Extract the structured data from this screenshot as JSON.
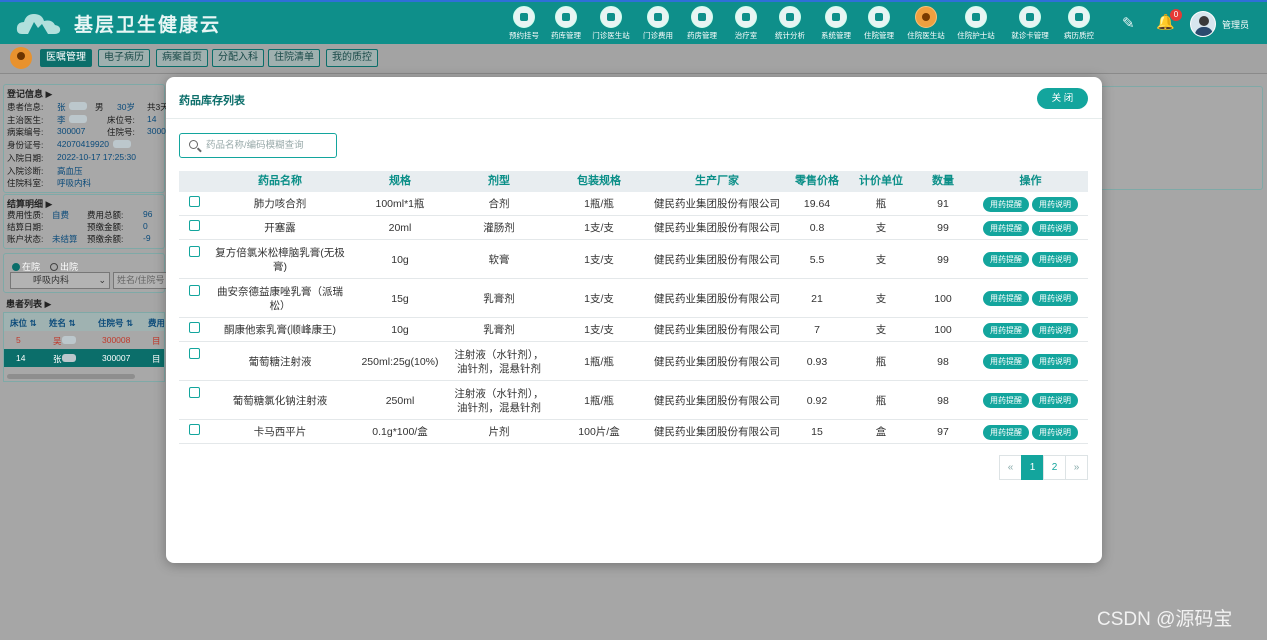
{
  "app": {
    "title": "基层卫生健康云"
  },
  "nav": {
    "items": [
      {
        "label": "预约挂号"
      },
      {
        "label": "药库管理"
      },
      {
        "label": "门诊医生站"
      },
      {
        "label": "门诊费用"
      },
      {
        "label": "药房管理"
      },
      {
        "label": "治疗室"
      },
      {
        "label": "统计分析"
      },
      {
        "label": "系统管理"
      },
      {
        "label": "住院管理"
      },
      {
        "label": "住院医生站",
        "active": true
      },
      {
        "label": "住院护士站"
      },
      {
        "label": "就诊卡管理"
      },
      {
        "label": "病历质控"
      }
    ],
    "notification_count": "0",
    "user_name": "管理员"
  },
  "subtabs": [
    {
      "label": "医嘱管理",
      "active": true
    },
    {
      "label": "电子病历"
    },
    {
      "label": "病案首页"
    },
    {
      "label": "分配入科"
    },
    {
      "label": "住院清单"
    },
    {
      "label": "我的质控"
    }
  ],
  "left": {
    "reg_title": "登记信息",
    "reg_rows": [
      [
        "患者信息:",
        "张",
        "男",
        "30岁",
        "共3天"
      ],
      [
        "主治医生:",
        "李",
        "床位号:",
        "14"
      ],
      [
        "病案编号:",
        "300007",
        "住院号:",
        "3000"
      ],
      [
        "身份证号:",
        "42070419920"
      ],
      [
        "入院日期:",
        "2022-10-17 17:25:30"
      ],
      [
        "入院诊断:",
        "高血压"
      ],
      [
        "住院科室:",
        "呼吸内科"
      ]
    ],
    "settle_title": "结算明细",
    "settle_rows": [
      [
        "费用性质:",
        "自费",
        "费用总额:",
        "96"
      ],
      [
        "结算日期:",
        "",
        "预缴金额:",
        "0"
      ],
      [
        "账户状态:",
        "未结算",
        "预缴余额:",
        "-9"
      ]
    ],
    "status_options": [
      "在院",
      "出院"
    ],
    "dept_select": "呼吸内科",
    "name_search_placeholder": "姓名/住院号",
    "patient_list_title": "患者列表",
    "patient_columns": [
      "床位",
      "姓名",
      "住院号",
      "费用"
    ],
    "patients": [
      {
        "bed": "5",
        "name": "吴",
        "no": "300008",
        "fee": "目"
      },
      {
        "bed": "14",
        "name": "张",
        "no": "300007",
        "fee": "目"
      }
    ]
  },
  "modal": {
    "title": "药品库存列表",
    "close_label": "关 闭",
    "search_placeholder": "药品名称/编码模糊查询",
    "columns": [
      "药品名称",
      "规格",
      "剂型",
      "包装规格",
      "生产厂家",
      "零售价格",
      "计价单位",
      "数量",
      "操作"
    ],
    "op_labels": [
      "用药提醒",
      "用药说明"
    ],
    "rows": [
      {
        "name": "肺力咳合剂",
        "spec": "100ml*1瓶",
        "form": "合剂",
        "pack": "1瓶/瓶",
        "maker": "健民药业集团股份有限公司",
        "price": "19.64",
        "unit": "瓶",
        "qty": "91"
      },
      {
        "name": "开塞露",
        "spec": "20ml",
        "form": "灌肠剂",
        "pack": "1支/支",
        "maker": "健民药业集团股份有限公司",
        "price": "0.8",
        "unit": "支",
        "qty": "99"
      },
      {
        "name": "复方倍氯米松樟脑乳膏(无极膏)",
        "spec": "10g",
        "form": "软膏",
        "pack": "1支/支",
        "maker": "健民药业集团股份有限公司",
        "price": "5.5",
        "unit": "支",
        "qty": "99"
      },
      {
        "name": "曲安奈德益康唑乳膏（派瑞松）",
        "spec": "15g",
        "form": "乳膏剂",
        "pack": "1支/支",
        "maker": "健民药业集团股份有限公司",
        "price": "21",
        "unit": "支",
        "qty": "100"
      },
      {
        "name": "酮康他索乳膏(顺峰康王)",
        "spec": "10g",
        "form": "乳膏剂",
        "pack": "1支/支",
        "maker": "健民药业集团股份有限公司",
        "price": "7",
        "unit": "支",
        "qty": "100"
      },
      {
        "name": "葡萄糖注射液",
        "spec": "250ml:25g(10%)",
        "form": "注射液（水针剂），油针剂，混悬针剂",
        "pack": "1瓶/瓶",
        "maker": "健民药业集团股份有限公司",
        "price": "0.93",
        "unit": "瓶",
        "qty": "98"
      },
      {
        "name": "葡萄糖氯化钠注射液",
        "spec": "250ml",
        "form": "注射液（水针剂），油针剂，混悬针剂",
        "pack": "1瓶/瓶",
        "maker": "健民药业集团股份有限公司",
        "price": "0.92",
        "unit": "瓶",
        "qty": "98"
      },
      {
        "name": "卡马西平片",
        "spec": "0.1g*100/盒",
        "form": "片剂",
        "pack": "100片/盒",
        "maker": "健民药业集团股份有限公司",
        "price": "15",
        "unit": "盒",
        "qty": "97"
      }
    ],
    "pager": {
      "prev": "«",
      "pages": [
        "1",
        "2"
      ],
      "current": "1",
      "next": "»"
    }
  },
  "watermark": "CSDN @源码宝",
  "colors": {
    "primary": "#13a59d",
    "header": "#0e8f8a",
    "accent_top": "#2f6fd8"
  },
  "icons": {
    "pencil": "pencil-icon",
    "bell": "bell-icon",
    "search": "search-icon",
    "logo": "cloud-logo"
  }
}
